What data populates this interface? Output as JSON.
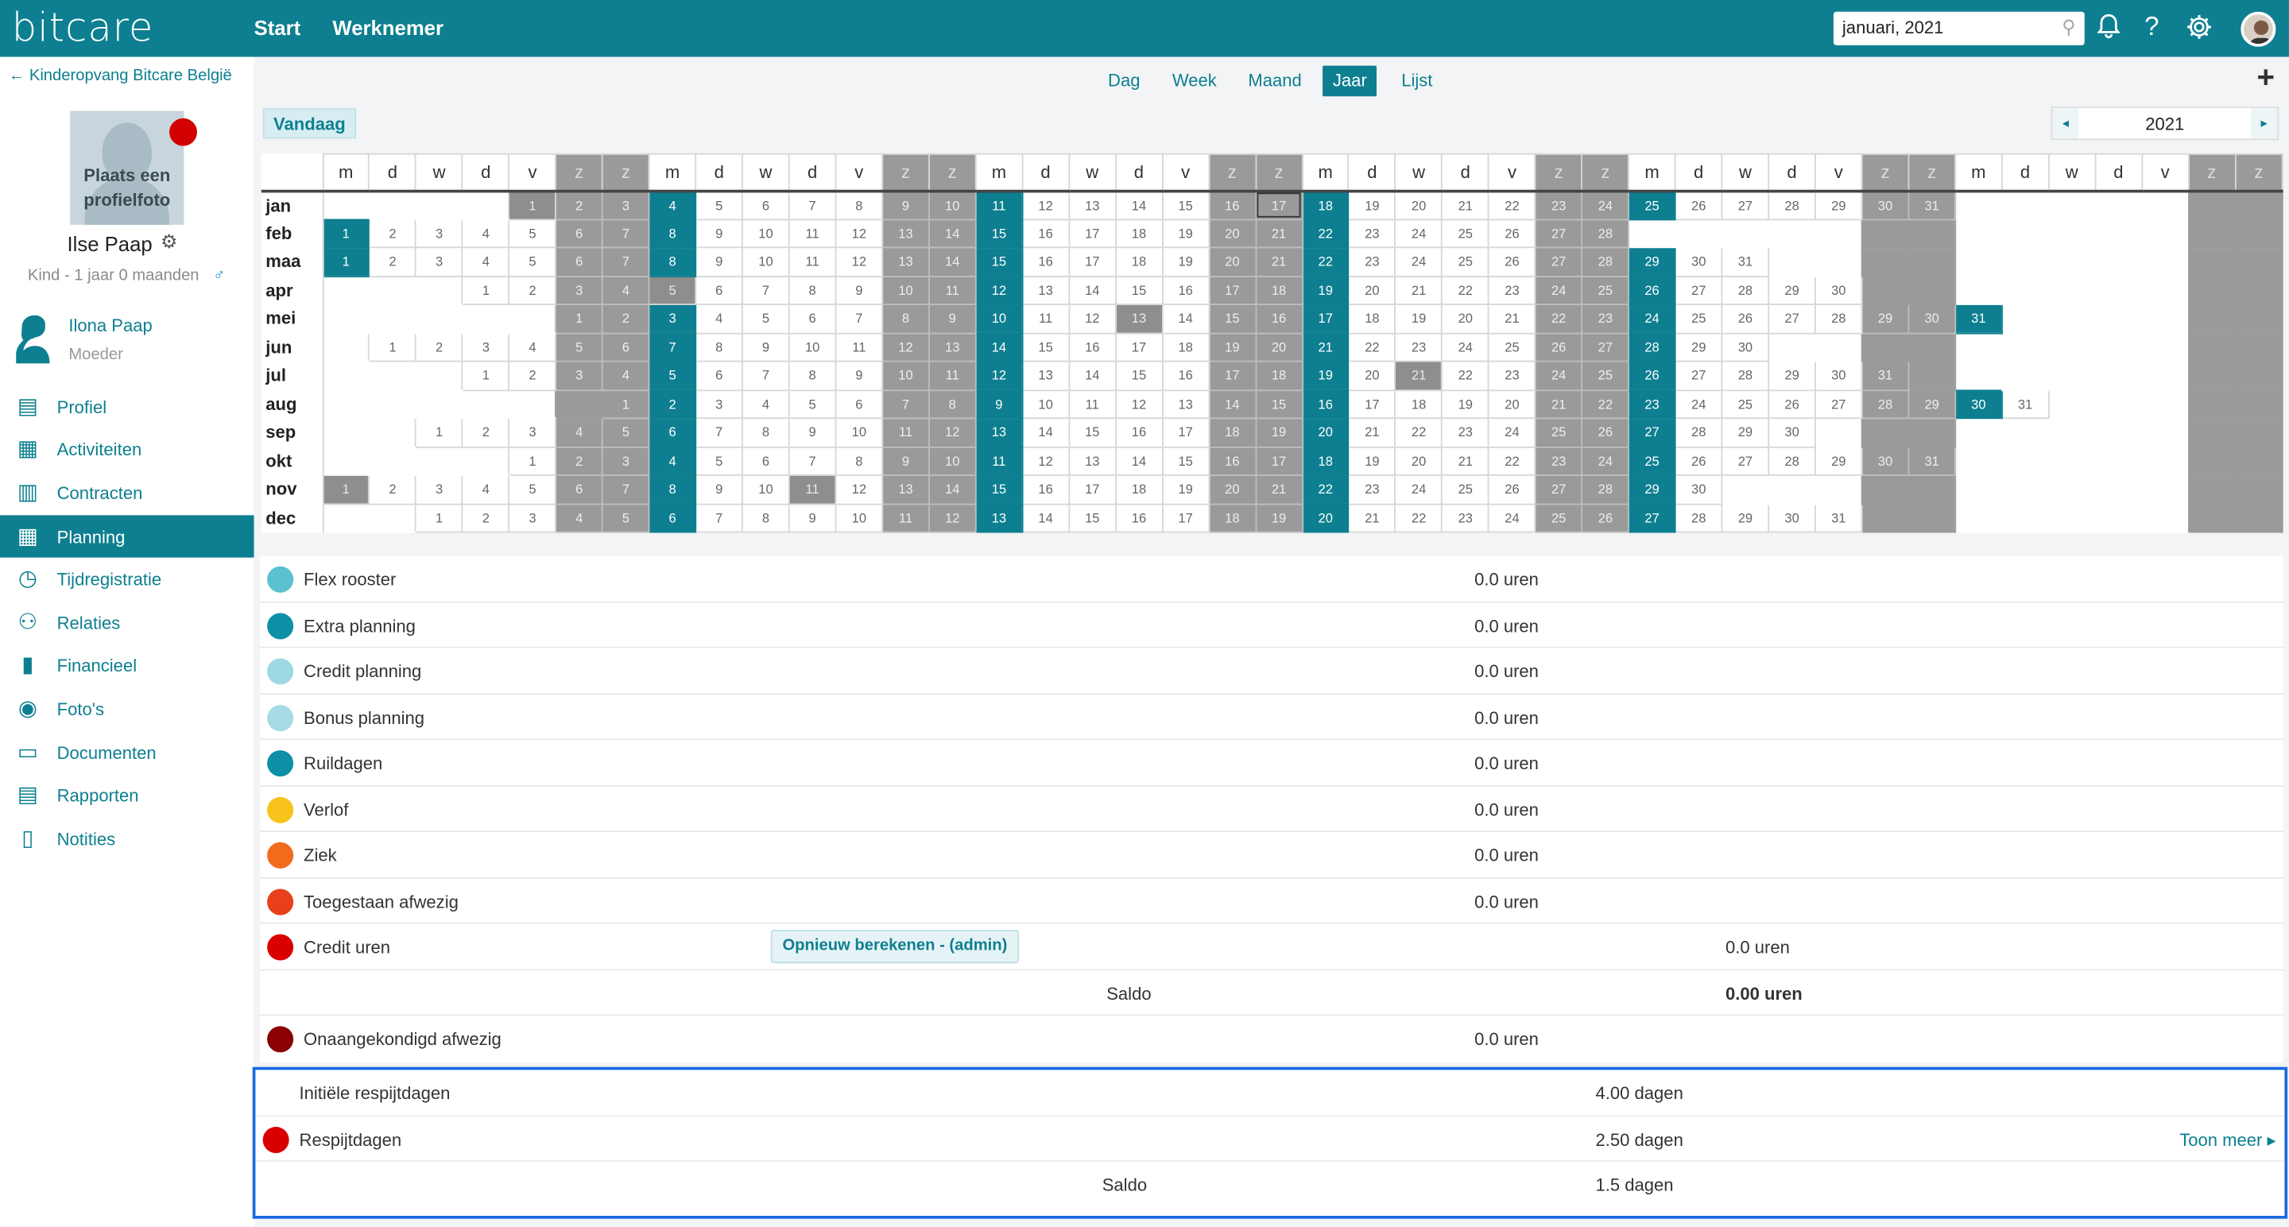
{
  "topbar": {
    "logo": "bitcare",
    "nav": [
      "Start",
      "Werknemer"
    ],
    "date_value": "januari, 2021",
    "icons": [
      "bell-icon",
      "help-icon",
      "gear-icon"
    ],
    "accent": "#0d7f90"
  },
  "sidebar": {
    "back_label": "← Kinderopvang Bitcare België",
    "photo_text": "Plaats een profielfoto",
    "name": "Ilse Paap",
    "kind": "Kind - 1 jaar 0 maanden",
    "male_symbol": "♂",
    "parent_name": "Ilona Paap",
    "parent_role": "Moeder",
    "items": [
      {
        "label": "Profiel",
        "icon": "person-card-icon",
        "glyph": "▤"
      },
      {
        "label": "Activiteiten",
        "icon": "table-icon",
        "glyph": "▦"
      },
      {
        "label": "Contracten",
        "icon": "document-icon",
        "glyph": "▥"
      },
      {
        "label": "Planning",
        "icon": "calendar-icon",
        "glyph": "▦",
        "active": true
      },
      {
        "label": "Tijdregistratie",
        "icon": "stopwatch-icon",
        "glyph": "◷"
      },
      {
        "label": "Relaties",
        "icon": "people-icon",
        "glyph": "⚇"
      },
      {
        "label": "Financieel",
        "icon": "bar-chart-icon",
        "glyph": "▮"
      },
      {
        "label": "Foto's",
        "icon": "camera-icon",
        "glyph": "◉"
      },
      {
        "label": "Documenten",
        "icon": "folder-icon",
        "glyph": "▭"
      },
      {
        "label": "Rapporten",
        "icon": "report-icon",
        "glyph": "▤"
      },
      {
        "label": "Notities",
        "icon": "clipboard-icon",
        "glyph": "▯"
      }
    ]
  },
  "viewtabs": {
    "tabs": [
      {
        "label": "Dag",
        "active": false
      },
      {
        "label": "Week",
        "active": false
      },
      {
        "label": "Maand",
        "active": false
      },
      {
        "label": "Jaar",
        "active": true
      },
      {
        "label": "Lijst",
        "active": false
      }
    ],
    "plus": "+"
  },
  "toolbar": {
    "today": "Vandaag",
    "year": "2021",
    "prev": "◂",
    "next": "▸"
  },
  "calendar": {
    "weekday_headers": [
      "m",
      "d",
      "w",
      "d",
      "v",
      "z",
      "z",
      "m",
      "d",
      "w",
      "d",
      "v",
      "z",
      "z",
      "m",
      "d",
      "w",
      "d",
      "v",
      "z",
      "z",
      "m",
      "d",
      "w",
      "d",
      "v",
      "z",
      "z",
      "m",
      "d",
      "w",
      "d",
      "v",
      "z",
      "z",
      "m",
      "d",
      "w",
      "d",
      "v",
      "z",
      "z"
    ],
    "months": [
      {
        "label": "jan",
        "offset": 4,
        "days": 31
      },
      {
        "label": "feb",
        "offset": 0,
        "days": 28
      },
      {
        "label": "maa",
        "offset": 0,
        "days": 31
      },
      {
        "label": "apr",
        "offset": 3,
        "days": 30
      },
      {
        "label": "mei",
        "offset": 5,
        "days": 31
      },
      {
        "label": "jun",
        "offset": 1,
        "days": 30
      },
      {
        "label": "jul",
        "offset": 3,
        "days": 31
      },
      {
        "label": "aug",
        "offset": 6,
        "days": 31
      },
      {
        "label": "sep",
        "offset": 2,
        "days": 30
      },
      {
        "label": "okt",
        "offset": 4,
        "days": 31
      },
      {
        "label": "nov",
        "offset": 0,
        "days": 30
      },
      {
        "label": "dec",
        "offset": 2,
        "days": 31
      }
    ],
    "special": {
      "jan": {
        "grey": [
          1
        ],
        "today": [
          17
        ]
      },
      "apr": {
        "grey": [
          5
        ]
      },
      "mei": {
        "teal": [
          31
        ]
      },
      "jun": {},
      "jul": {},
      "aug": {
        "teal": [
          30
        ]
      },
      "nov": {
        "grey": [
          1,
          11
        ]
      },
      "mei_grey": [
        13
      ],
      "jun_grey": [],
      "jul_grey": [],
      "aug_grey": [],
      "jul_extra": [],
      "jun_extra": [],
      "mei_extra": [],
      "jul21": [
        21
      ]
    }
  },
  "stats": {
    "rows": [
      {
        "label": "Flex rooster",
        "value": "0.0 uren",
        "color": "#5bc0d0"
      },
      {
        "label": "Extra planning",
        "value": "0.0 uren",
        "color": "#0d8fa8"
      },
      {
        "label": "Credit planning",
        "value": "0.0 uren",
        "color": "#9dd9e3"
      },
      {
        "label": "Bonus planning",
        "value": "0.0 uren",
        "color": "#a6dbe5"
      },
      {
        "label": "Ruildagen",
        "value": "0.0 uren",
        "color": "#0d8fa8"
      },
      {
        "label": "Verlof",
        "value": "0.0 uren",
        "color": "#f8c31a"
      },
      {
        "label": "Ziek",
        "value": "0.0 uren",
        "color": "#f26b1d"
      },
      {
        "label": "Toegestaan afwezig",
        "value": "0.0 uren",
        "color": "#e8401a"
      }
    ],
    "credit": {
      "label": "Credit uren",
      "value": "0.0 uren",
      "color": "#d90000",
      "button": "Opnieuw berekenen - (admin)"
    },
    "credit_saldo": {
      "label": "Saldo",
      "value": "0.00 uren"
    },
    "onaang": {
      "label": "Onaangekondigd afwezig",
      "value": "0.0 uren",
      "color": "#8b0000"
    }
  },
  "respijt": {
    "initial": {
      "label": "Initiële respijtdagen",
      "value": "4.00 dagen"
    },
    "used": {
      "label": "Respijtdagen",
      "value": "2.50 dagen",
      "color": "#d90000",
      "link": "Toon meer ▸"
    },
    "saldo": {
      "label": "Saldo",
      "value": "1.5 dagen"
    },
    "border_color": "#1769e0"
  }
}
